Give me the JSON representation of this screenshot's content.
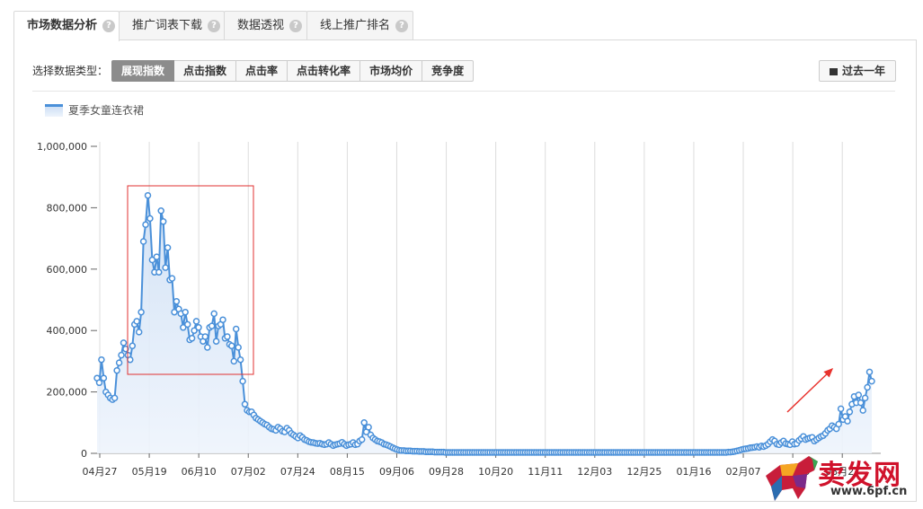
{
  "tabs": [
    {
      "label": "市场数据分析",
      "help": "?"
    },
    {
      "label": "推广词表下载",
      "help": "?"
    },
    {
      "label": "数据透视",
      "help": "?"
    },
    {
      "label": "线上推广排名",
      "help": "?"
    }
  ],
  "data_type": {
    "label": "选择数据类型：",
    "options": [
      "展现指数",
      "点击指数",
      "点击率",
      "点击转化率",
      "市场均价",
      "竞争度"
    ],
    "selected": "展现指数"
  },
  "range_button": {
    "label": "过去一年",
    "icon": "calendar-icon"
  },
  "watermark": {
    "text": "卖发网",
    "url": "www.6pf.cn"
  },
  "colors": {
    "line": "#4a90d9",
    "area_top": "#cfe0f5",
    "highlight_box": "#e03030",
    "arrow": "#e8322d"
  },
  "chart_data": {
    "type": "area",
    "legend": [
      "夏季女童连衣裙"
    ],
    "y_ticks": [
      "0",
      "200,000",
      "400,000",
      "600,000",
      "800,000",
      "1,000,000"
    ],
    "ylim": [
      0,
      1000000
    ],
    "x_ticks": [
      "04月27",
      "05月19",
      "06月10",
      "07月02",
      "07月24",
      "08月15",
      "09月06",
      "09月28",
      "10月20",
      "11月11",
      "12月03",
      "12月25",
      "01月16",
      "02月07",
      "02月29",
      "03月2?"
    ],
    "series": [
      {
        "name": "夏季女童连衣裙",
        "values": [
          245000,
          230000,
          305000,
          245000,
          200000,
          190000,
          180000,
          175000,
          180000,
          270000,
          295000,
          320000,
          360000,
          340000,
          320000,
          305000,
          350000,
          420000,
          430000,
          395000,
          460000,
          690000,
          745000,
          840000,
          765000,
          630000,
          590000,
          640000,
          590000,
          790000,
          755000,
          605000,
          670000,
          565000,
          570000,
          460000,
          495000,
          470000,
          455000,
          410000,
          460000,
          420000,
          370000,
          375000,
          400000,
          430000,
          410000,
          380000,
          365000,
          380000,
          345000,
          410000,
          415000,
          455000,
          365000,
          415000,
          420000,
          435000,
          375000,
          380000,
          355000,
          350000,
          300000,
          405000,
          345000,
          305000,
          235000,
          160000,
          140000,
          135000,
          135000,
          125000,
          115000,
          110000,
          105000,
          100000,
          95000,
          92000,
          85000,
          80000,
          78000,
          75000,
          85000,
          80000,
          72000,
          70000,
          82000,
          75000,
          65000,
          60000,
          55000,
          50000,
          58000,
          52000,
          45000,
          42000,
          38000,
          36000,
          35000,
          33000,
          32000,
          33000,
          30000,
          28000,
          30000,
          35000,
          30000,
          25000,
          28000,
          30000,
          32000,
          36000,
          30000,
          25000,
          28000,
          30000,
          35000,
          28000,
          30000,
          40000,
          45000,
          100000,
          70000,
          85000,
          60000,
          50000,
          45000,
          40000,
          38000,
          35000,
          30000,
          28000,
          25000,
          22000,
          18000,
          15000,
          12000,
          10000,
          9000,
          9000,
          8000,
          8000,
          8000,
          7000,
          7000,
          7000,
          6000,
          6000,
          6000,
          5000,
          5000,
          5000,
          5000,
          4000,
          4000,
          4000,
          4000,
          4000,
          3000,
          3000,
          3000,
          3000,
          3000,
          3000,
          3000,
          3000,
          3000,
          3000,
          3000,
          3000,
          3000,
          3000,
          3000,
          3000,
          3000,
          3000,
          3000,
          3000,
          3000,
          3000,
          3000,
          3000,
          3000,
          3000,
          3000,
          3000,
          3000,
          3000,
          3000,
          3000,
          3000,
          3000,
          3000,
          3000,
          3000,
          3000,
          3000,
          3000,
          3000,
          3000,
          3000,
          3000,
          3000,
          3000,
          3000,
          3000,
          3000,
          3000,
          3000,
          3000,
          3000,
          3000,
          3000,
          3000,
          3000,
          3000,
          3000,
          3000,
          3000,
          3000,
          3000,
          3000,
          3000,
          3000,
          3000,
          3000,
          3000,
          3000,
          3000,
          3000,
          3000,
          3000,
          3000,
          3000,
          3000,
          3000,
          3000,
          3000,
          3000,
          3000,
          3000,
          3000,
          3000,
          3000,
          3000,
          3000,
          3000,
          3000,
          3000,
          3000,
          3000,
          3000,
          3000,
          3000,
          3000,
          3000,
          3000,
          3000,
          3000,
          3000,
          3000,
          3000,
          3000,
          3000,
          3000,
          3000,
          3000,
          3000,
          3000,
          3000,
          3000,
          3000,
          3000,
          3000,
          3000,
          3000,
          3000,
          3000,
          3000,
          3000,
          3000,
          3000,
          3000,
          3000,
          3000,
          3000,
          4000,
          4000,
          5000,
          6000,
          8000,
          10000,
          12000,
          14000,
          15000,
          16000,
          18000,
          19000,
          20000,
          22000,
          20000,
          24000,
          22000,
          25000,
          30000,
          38000,
          45000,
          40000,
          30000,
          28000,
          35000,
          40000,
          32000,
          30000,
          28000,
          38000,
          30000,
          32000,
          42000,
          48000,
          55000,
          45000,
          48000,
          50000,
          52000,
          40000,
          45000,
          50000,
          55000,
          58000,
          65000,
          75000,
          80000,
          90000,
          85000,
          80000,
          95000,
          145000,
          110000,
          120000,
          105000,
          135000,
          160000,
          185000,
          165000,
          190000,
          165000,
          140000,
          180000,
          215000,
          265000,
          235000
        ]
      }
    ]
  }
}
